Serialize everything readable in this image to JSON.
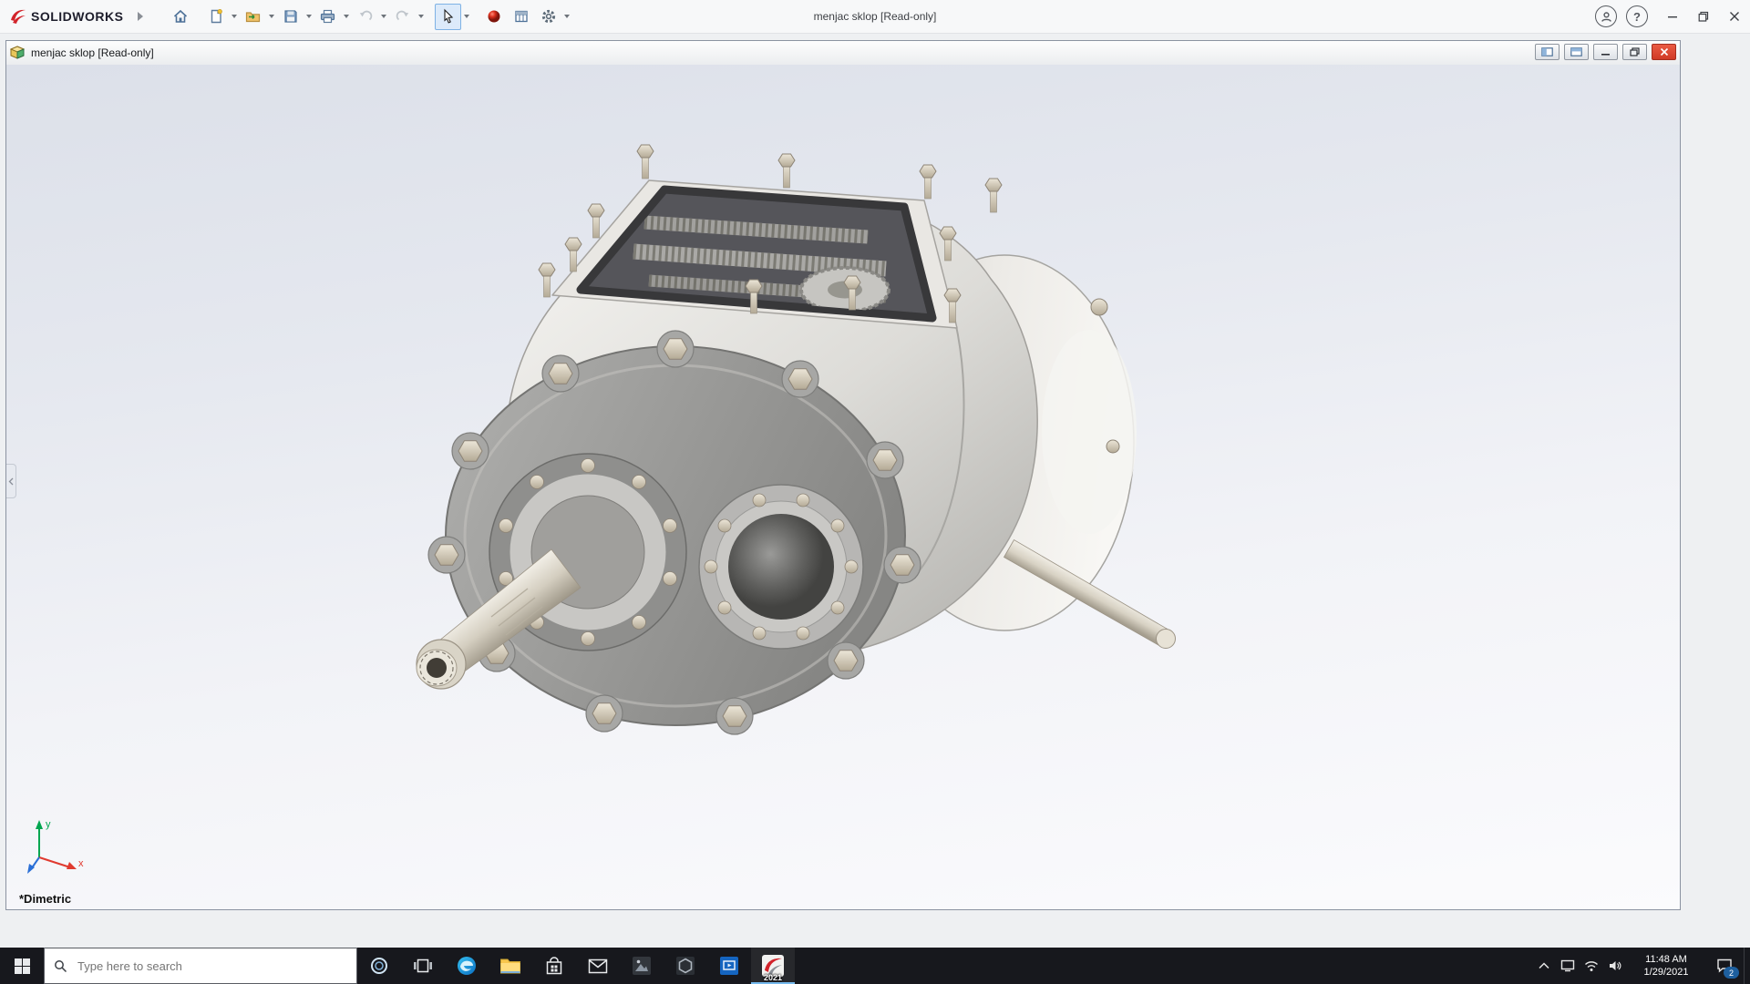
{
  "app": {
    "brand": "SOLIDWORKS",
    "title": "menjac sklop [Read-only]",
    "toolbar_icons": [
      "home-icon",
      "new-document-icon",
      "open-icon",
      "save-icon",
      "print-icon",
      "undo-icon",
      "redo-icon",
      "select-arrow-icon",
      "appearance-sphere-icon",
      "design-table-icon",
      "options-gear-icon"
    ],
    "glyphs": {
      "help": "?"
    }
  },
  "doc_window": {
    "title": "menjac sklop [Read-only]"
  },
  "viewport": {
    "view_orientation": "*Dimetric",
    "triad": {
      "x_label": "x",
      "y_label": "y"
    }
  },
  "taskbar": {
    "search_placeholder": "Type here to search",
    "pinned_icons": [
      "start-icon",
      "cortana-icon",
      "task-view-icon",
      "edge-icon",
      "file-explorer-icon",
      "store-icon",
      "mail-icon",
      "photos-icon",
      "hexagon-app-icon",
      "blue-app-icon",
      "solidworks-icon"
    ],
    "solidworks_version_badge": "2021",
    "tray": {
      "time": "11:48 AM",
      "date": "1/29/2021",
      "notification_count": "2"
    }
  }
}
